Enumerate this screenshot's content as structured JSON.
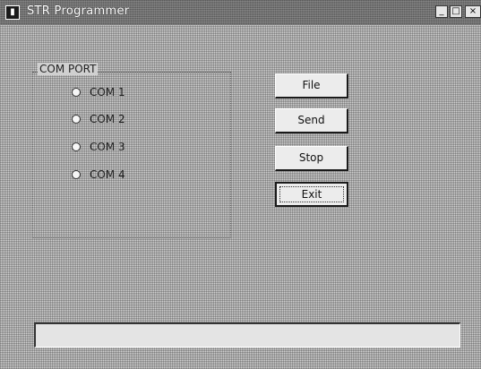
{
  "window": {
    "title": "STR Programmer",
    "icon_glyph": "▮",
    "controls": {
      "minimize": "_",
      "maximize": "□",
      "close": "×"
    }
  },
  "com_port_group": {
    "label": "COM PORT",
    "options": [
      {
        "label": "COM 1",
        "selected": false
      },
      {
        "label": "COM 2",
        "selected": false
      },
      {
        "label": "COM 3",
        "selected": false
      },
      {
        "label": "COM 4",
        "selected": false
      }
    ]
  },
  "buttons": {
    "file": "File",
    "send": "Send",
    "stop": "Stop",
    "exit": "Exit"
  },
  "status": {
    "text": ""
  }
}
